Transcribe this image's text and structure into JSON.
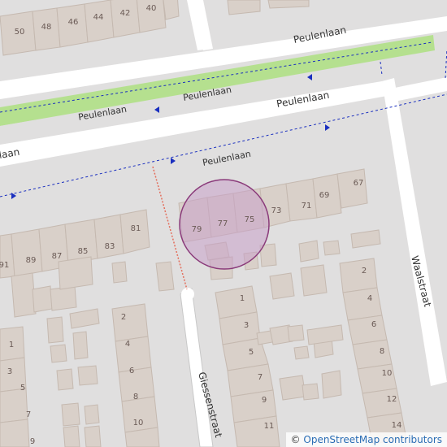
{
  "map": {
    "streets": {
      "peulenlaan_top": "Peulenlaan",
      "peulenlaan_mid": "Peulenlaan",
      "peulenlaan_main": "Peulenlaan",
      "peulenlaan_left": "Peulenlaan",
      "peulenlaan_path": "Peulenlaan",
      "waalstraat": "Waalstraat",
      "giessenstraat": "Giessenstraat"
    },
    "house_numbers": {
      "n50": "50",
      "n48": "48",
      "n46": "46",
      "n44": "44",
      "n42": "42",
      "n40": "40",
      "n79": "79",
      "n77": "77",
      "n75": "75",
      "n73": "73",
      "n71": "71",
      "n69": "69",
      "n67": "67",
      "n91": "91",
      "n89": "89",
      "n87": "87",
      "n85": "85",
      "n83": "83",
      "n81": "81",
      "n2a": "2",
      "n4a": "4",
      "n6a": "6",
      "n8a": "8",
      "n10a": "10",
      "n1b": "1",
      "n3b": "3",
      "n5b": "5",
      "n7b": "7",
      "n9b": "9",
      "n11b": "11",
      "n2c": "2",
      "n4c": "4",
      "n6c": "6",
      "n8c": "8",
      "n10c": "10",
      "n12c": "12",
      "n14c": "14",
      "n1d": "1",
      "n3d": "3",
      "n5d": "5",
      "n7d": "7",
      "n9d": "9"
    }
  },
  "attribution": {
    "prefix": "© ",
    "link_text": "OpenStreetMap contributors"
  },
  "colors": {
    "marker_fill": "#c8a0c8",
    "marker_stroke": "#8a3a7a",
    "road": "#ffffff",
    "green_strip": "#b5e08f",
    "building": "#d9d0c9",
    "footway": "#e36d5b",
    "cycle_arrows": "#1a2fbf"
  }
}
